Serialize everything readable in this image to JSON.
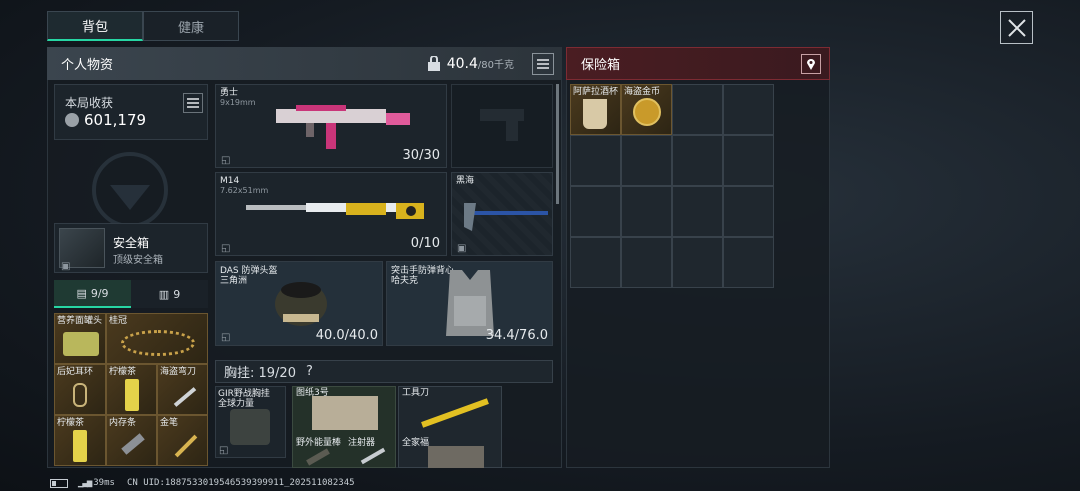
{
  "tabs": [
    {
      "label": "背包"
    },
    {
      "label": "健康"
    }
  ],
  "personal": {
    "title": "个人物资",
    "weight_value": "40.4",
    "weight_max": "/80千克",
    "earnings_label": "本局收获",
    "earnings_value": "601,179"
  },
  "safebox": {
    "title": "安全箱",
    "subtitle": "顶级安全箱"
  },
  "pouch_tabs": [
    {
      "label": "9/9"
    },
    {
      "label": "9"
    }
  ],
  "pouch_items": [
    {
      "name": "营养面罐头"
    },
    {
      "name": "桂冠"
    },
    {
      "name": "后妃耳环"
    },
    {
      "name": "柠檬茶"
    },
    {
      "name": "海盗弯刀"
    },
    {
      "name": "柠檬茶"
    },
    {
      "name": "内存条"
    },
    {
      "name": "金笔"
    }
  ],
  "weapons": [
    {
      "name": "勇士",
      "caliber": "9x19mm",
      "ammo": "30/30"
    },
    {
      "name": "M14",
      "caliber": "7.62x51mm",
      "ammo": "0/10"
    }
  ],
  "melee": {
    "name": "黑海"
  },
  "armor": [
    {
      "name": "DAS 防弹头盔",
      "sub": "三角洲",
      "durability": "40.0/40.0"
    },
    {
      "name": "突击手防弹背心",
      "sub": "哈夫克",
      "durability": "34.4/76.0"
    }
  ],
  "chest_rig": {
    "label": "胸挂: 19/20",
    "help": "?"
  },
  "rig_items": [
    {
      "name": "GIR野战胸挂",
      "sub": "全球力量"
    },
    {
      "name": "图纸3号"
    },
    {
      "name": "工具刀"
    },
    {
      "name": "野外能量棒"
    },
    {
      "name": "注射器"
    },
    {
      "name": "全家福"
    }
  ],
  "secure": {
    "title": "保险箱",
    "items": [
      {
        "name": "阿萨拉酒杯"
      },
      {
        "name": "海盗金币"
      }
    ]
  },
  "status": {
    "ping": "39ms",
    "uid": "CN UID:1887533019546539399911_202511082345"
  }
}
